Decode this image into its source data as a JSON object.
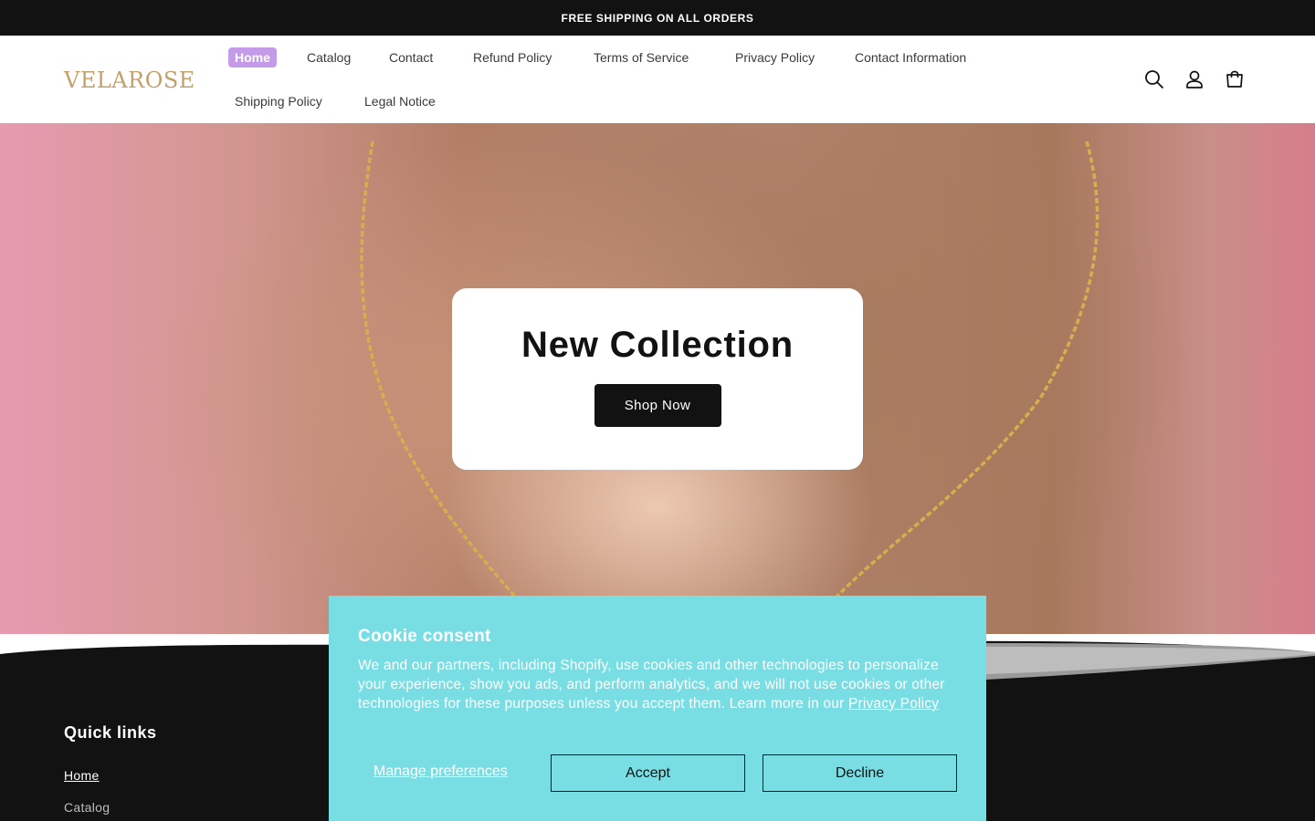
{
  "announcement": "FREE SHIPPING ON ALL ORDERS",
  "header": {
    "logo_text": "VELAROSE",
    "nav": [
      {
        "label": "Home",
        "active": true
      },
      {
        "label": "Catalog"
      },
      {
        "label": "Contact"
      },
      {
        "label": "Refund Policy"
      },
      {
        "label": "Terms of Service"
      },
      {
        "label": "Privacy Policy"
      },
      {
        "label": "Contact Information"
      },
      {
        "label": "Shipping Policy"
      },
      {
        "label": "Legal Notice"
      }
    ],
    "icons": [
      "search-icon",
      "account-icon",
      "cart-icon"
    ]
  },
  "hero": {
    "title": "New Collection",
    "button_label": "Shop Now"
  },
  "footer": {
    "heading": "Quick links",
    "links": [
      "Home",
      "Catalog"
    ]
  },
  "cookie": {
    "title": "Cookie consent",
    "body": "We and our partners, including Shopify, use cookies and other technologies to personalize your experience, show you ads, and perform analytics, and we will not use cookies or other technologies for these purposes unless you accept them. Learn more in our ",
    "policy_link": "Privacy Policy",
    "manage_label": "Manage preferences",
    "accept_label": "Accept",
    "decline_label": "Decline"
  },
  "colors": {
    "accent_nav": "#c49be8",
    "cookie_bg": "#79dee3",
    "dark": "#121212"
  }
}
